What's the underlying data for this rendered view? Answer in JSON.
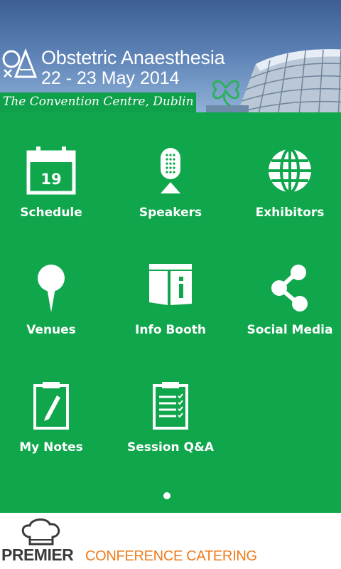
{
  "header": {
    "title": "Obstetric Anaesthesia",
    "dates": "22 - 23 May 2014",
    "venue": "The Convention Centre, Dublin",
    "logo_icon": "oaa-logo-icon",
    "shamrock_icon": "shamrock-icon"
  },
  "menu": {
    "background": "#0fa64c",
    "items": [
      {
        "label": "Schedule",
        "icon": "calendar-icon"
      },
      {
        "label": "Speakers",
        "icon": "microphone-icon"
      },
      {
        "label": "Exhibitors",
        "icon": "globe-icon"
      },
      {
        "label": "Venues",
        "icon": "map-pin-icon"
      },
      {
        "label": "Info Booth",
        "icon": "info-booth-icon"
      },
      {
        "label": "Social Media",
        "icon": "share-icon"
      },
      {
        "label": "My Notes",
        "icon": "notes-icon"
      },
      {
        "label": "Session Q&A",
        "icon": "checklist-icon"
      }
    ],
    "calendar_day": "19",
    "page_indicator": {
      "current": 1,
      "total": 1
    }
  },
  "footer": {
    "sponsor_name": "PREMIER",
    "sponsor_tagline": "CONFERENCE CATERING",
    "sponsor_color": "#ee7b1c"
  }
}
